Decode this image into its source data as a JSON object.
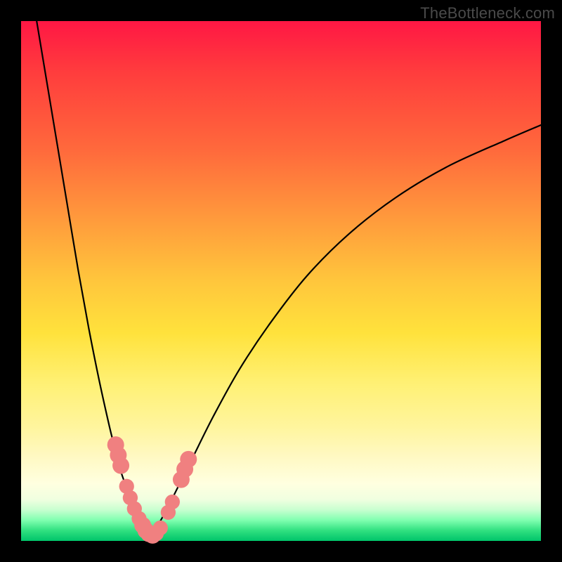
{
  "watermark": "TheBottleneck.com",
  "chart_data": {
    "type": "line",
    "title": "",
    "xlabel": "",
    "ylabel": "",
    "xlim": [
      0,
      100
    ],
    "ylim": [
      0,
      100
    ],
    "series": [
      {
        "name": "left-curve",
        "x": [
          3,
          5,
          7,
          9,
          11,
          13,
          15,
          17,
          18,
          19,
          20,
          21,
          22,
          23,
          24,
          25
        ],
        "y": [
          100,
          88,
          76,
          64,
          52,
          41,
          31,
          22,
          18,
          14,
          11,
          8,
          5.5,
          3.5,
          2,
          1
        ]
      },
      {
        "name": "right-curve",
        "x": [
          25,
          26,
          28,
          30,
          33,
          37,
          42,
          48,
          55,
          63,
          72,
          82,
          93,
          100
        ],
        "y": [
          1,
          2.5,
          6,
          10,
          16,
          24,
          33,
          42,
          51,
          59,
          66,
          72,
          77,
          80
        ]
      }
    ],
    "markers": {
      "name": "highlighted-points",
      "color": "#f08080",
      "points": [
        {
          "x": 18.2,
          "y": 18.5,
          "r": 1.2
        },
        {
          "x": 18.7,
          "y": 16.5,
          "r": 1.2
        },
        {
          "x": 19.2,
          "y": 14.5,
          "r": 1.2
        },
        {
          "x": 20.3,
          "y": 10.5,
          "r": 1.0
        },
        {
          "x": 21.0,
          "y": 8.3,
          "r": 1.0
        },
        {
          "x": 21.8,
          "y": 6.2,
          "r": 1.0
        },
        {
          "x": 22.7,
          "y": 4.3,
          "r": 1.0
        },
        {
          "x": 23.4,
          "y": 3.0,
          "r": 1.2
        },
        {
          "x": 24.0,
          "y": 2.0,
          "r": 1.2
        },
        {
          "x": 24.6,
          "y": 1.4,
          "r": 1.2
        },
        {
          "x": 25.3,
          "y": 1.1,
          "r": 1.2
        },
        {
          "x": 26.0,
          "y": 1.4,
          "r": 1.0
        },
        {
          "x": 26.8,
          "y": 2.5,
          "r": 1.0
        },
        {
          "x": 28.3,
          "y": 5.5,
          "r": 1.0
        },
        {
          "x": 29.1,
          "y": 7.5,
          "r": 1.0
        },
        {
          "x": 30.8,
          "y": 11.8,
          "r": 1.2
        },
        {
          "x": 31.5,
          "y": 13.8,
          "r": 1.2
        },
        {
          "x": 32.2,
          "y": 15.7,
          "r": 1.2
        }
      ]
    }
  }
}
